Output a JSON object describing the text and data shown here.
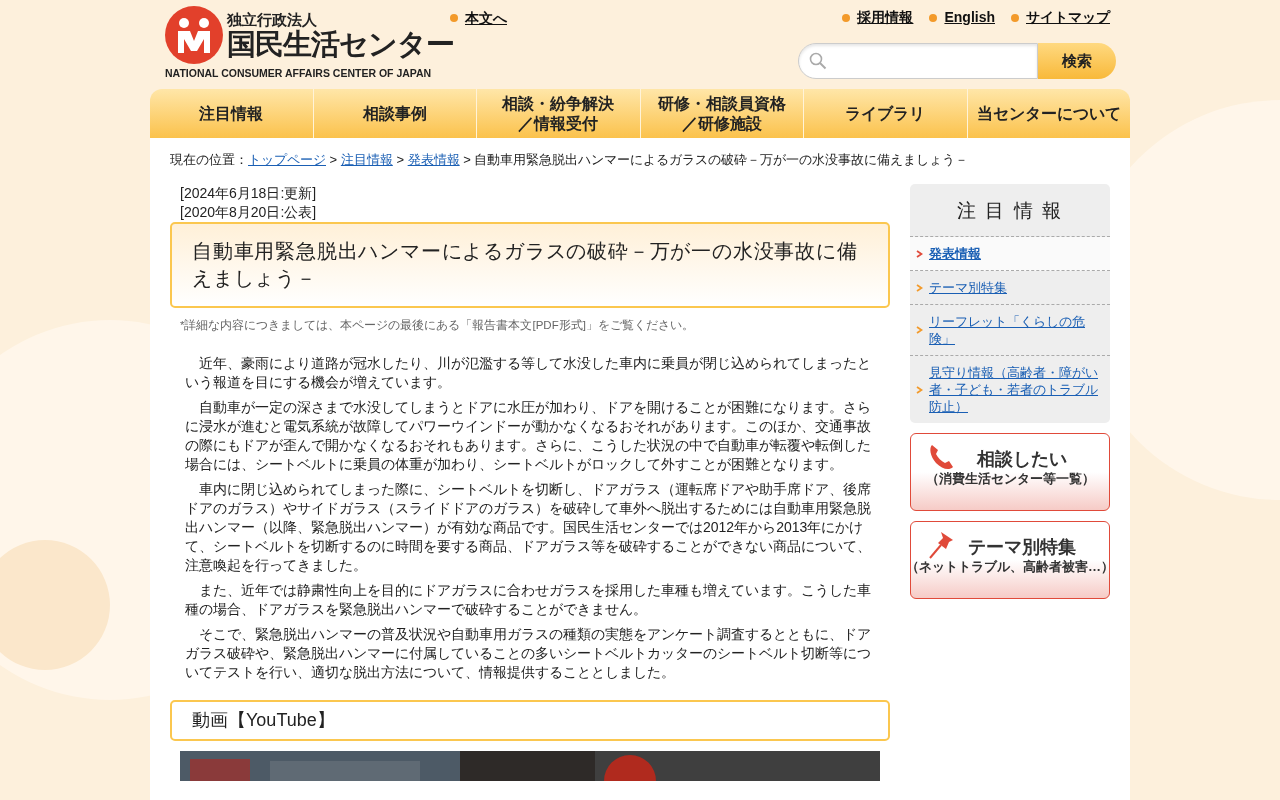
{
  "header": {
    "logo": {
      "org_type": "独立行政法人",
      "name": "国民生活センター",
      "english": "NATIONAL CONSUMER AFFAIRS CENTER OF JAPAN"
    },
    "skip_link": "本文へ",
    "utility_links": [
      "採用情報",
      "English",
      "サイトマップ"
    ],
    "search": {
      "button": "検索"
    }
  },
  "nav": [
    {
      "lines": [
        "注目情報"
      ]
    },
    {
      "lines": [
        "相談事例"
      ]
    },
    {
      "lines": [
        "相談・紛争解決",
        "／情報受付"
      ]
    },
    {
      "lines": [
        "研修・相談員資格",
        "／研修施設"
      ]
    },
    {
      "lines": [
        "ライブラリ"
      ]
    },
    {
      "lines": [
        "当センターについて"
      ]
    }
  ],
  "breadcrumb": {
    "label": "現在の位置：",
    "links": [
      "トップページ",
      "注目情報",
      "発表情報"
    ],
    "separator": ">",
    "current": "自動車用緊急脱出ハンマーによるガラスの破砕－万が一の水没事故に備えましょう－"
  },
  "article": {
    "dates": [
      "[2024年6月18日:更新]",
      "[2020年8月20日:公表]"
    ],
    "title": "自動車用緊急脱出ハンマーによるガラスの破砕－万が一の水没事故に備えましょう－",
    "note": "*詳細な内容につきましては、本ページの最後にある「報告書本文[PDF形式]」をご覧ください。",
    "paragraphs": [
      "近年、豪雨により道路が冠水したり、川が氾濫する等して水没した車内に乗員が閉じ込められてしまったという報道を目にする機会が増えています。",
      "自動車が一定の深さまで水没してしまうとドアに水圧が加わり、ドアを開けることが困難になります。さらに浸水が進むと電気系統が故障してパワーウインドーが動かなくなるおそれがあります。このほか、交通事故の際にもドアが歪んで開かなくなるおそれもあります。さらに、こうした状況の中で自動車が転覆や転倒した場合には、シートベルトに乗員の体重が加わり、シートベルトがロックして外すことが困難となります。",
      "車内に閉じ込められてしまった際に、シートベルトを切断し、ドアガラス（運転席ドアや助手席ドア、後席ドアのガラス）やサイドガラス（スライドドアのガラス）を破砕して車外へ脱出するためには自動車用緊急脱出ハンマー（以降、緊急脱出ハンマー）が有効な商品です。国民生活センターでは2012年から2013年にかけて、シートベルトを切断するのに時間を要する商品、ドアガラス等を破砕することができない商品について、注意喚起を行ってきました。",
      "また、近年では静粛性向上を目的にドアガラスに合わせガラスを採用した車種も増えています。こうした車種の場合、ドアガラスを緊急脱出ハンマーで破砕することができません。",
      "そこで、緊急脱出ハンマーの普及状況や自動車用ガラスの種類の実態をアンケート調査するとともに、ドアガラス破砕や、緊急脱出ハンマーに付属していることの多いシートベルトカッターのシートベルト切断等についてテストを行い、適切な脱出方法について、情報提供することとしました。"
    ],
    "video_heading": "動画【YouTube】",
    "video": {
      "kind": "picture"
    }
  },
  "sidebar": {
    "title": "注 目 情 報",
    "items": [
      {
        "label": "発表情報",
        "selected": true
      },
      {
        "label": "テーマ別特集",
        "selected": false
      },
      {
        "label": "リーフレット「くらしの危険」",
        "selected": false
      },
      {
        "label": "見守り情報（高齢者・障がい者・子ども・若者のトラブル防止）",
        "selected": false
      }
    ],
    "banners": [
      {
        "kind": "phone",
        "title": "相談したい",
        "subtitle": "（消費生活センター等一覧）"
      },
      {
        "kind": "pin",
        "title": "テーマ別特集",
        "subtitle": "（ネットトラブル、高齢者被害…）"
      }
    ]
  }
}
